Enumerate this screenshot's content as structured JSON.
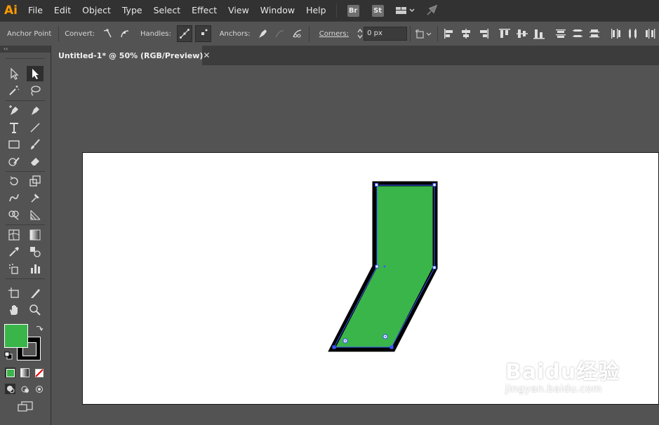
{
  "app": {
    "logo": "Ai"
  },
  "menu": [
    "File",
    "Edit",
    "Object",
    "Type",
    "Select",
    "Effect",
    "View",
    "Window",
    "Help"
  ],
  "app_badges": [
    "Br",
    "St"
  ],
  "control_bar": {
    "mode_label": "Anchor Point",
    "convert_label": "Convert:",
    "handles_label": "Handles:",
    "anchors_label": "Anchors:",
    "corners_label": "Corners:",
    "corners_value": "0 px"
  },
  "document": {
    "tab_title": "Untitled-1* @ 50% (RGB/Preview)",
    "close_glyph": "✕"
  },
  "colors": {
    "fill": "#3ab54a",
    "stroke": "#000000",
    "path": "#3d5afe"
  },
  "icons": {
    "tools": [
      "selection-icon",
      "direct-selection-icon",
      "magic-wand-icon",
      "lasso-icon",
      "pen-icon",
      "curvature-icon",
      "type-icon",
      "line-segment-icon",
      "rectangle-icon",
      "paintbrush-icon",
      "shaper-icon",
      "eraser-icon",
      "rotate-icon",
      "scale-icon",
      "warp-icon",
      "free-transform-icon",
      "shape-builder-icon",
      "perspective-grid-icon",
      "mesh-icon",
      "gradient-icon",
      "eyedropper-icon",
      "blend-icon",
      "symbol-sprayer-icon",
      "column-graph-icon",
      "artboard-icon",
      "slice-icon",
      "hand-icon",
      "zoom-icon"
    ]
  },
  "watermark": {
    "main": "Baidu经验",
    "sub": "jingyan.baidu.com"
  }
}
